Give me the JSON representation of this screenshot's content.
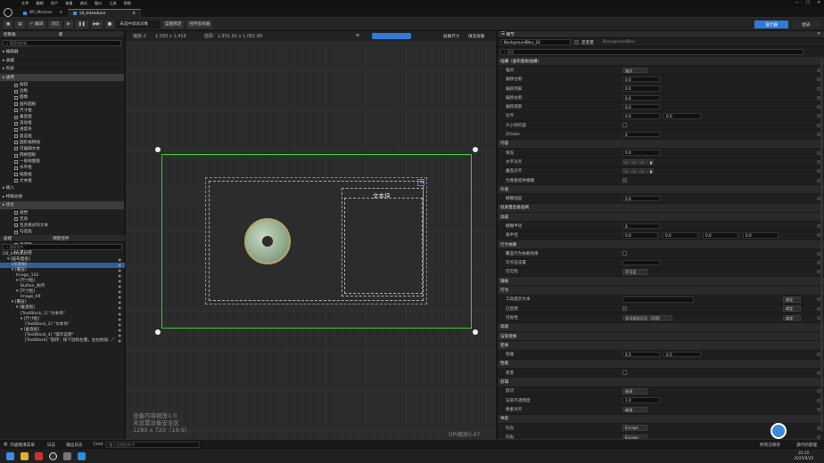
{
  "menu": {
    "items": [
      "文件",
      "编辑",
      "资产",
      "查看",
      "调试",
      "窗口",
      "工具",
      "帮助"
    ]
  },
  "window": {
    "controls": [
      "—",
      "☐",
      "✕"
    ]
  },
  "tabs": [
    {
      "label": "BP_Meshes"
    },
    {
      "label": "UI_Introduce"
    }
  ],
  "toolbar": {
    "compile_label": "编译",
    "diff_label": "对比",
    "debug_select": "未选中调试对象",
    "blueprint_label": "蓝图绑定",
    "asset_label": "控件反射器",
    "designer_label": "设计器",
    "graph_label": "图表"
  },
  "palette": {
    "title": "控制板",
    "library_title": "库",
    "search_placeholder": "搜索控制板",
    "categories_top": [
      "编辑器",
      "收藏",
      "列表",
      "通用"
    ],
    "common_items": [
      "按钮",
      "边框",
      "图像",
      "画布面板",
      "尺寸框",
      "垂直框",
      "滚动框",
      "进度条",
      "复选框",
      "圆形抛物线",
      "可编辑文本",
      "网格面板",
      "一般视图框",
      "水平框",
      "缩放框",
      "文本框"
    ],
    "categories_bottom": [
      "输入",
      "特殊效果",
      "优化"
    ],
    "optimization_items": [
      "视觉",
      "无效",
      "包含格式的文本",
      "勾选框",
      "文本",
      "滚动条",
      "垂直框"
    ]
  },
  "hierarchy": {
    "title": "层级",
    "bind_title": "绑定控件",
    "search_placeholder": "搜索控件",
    "rows": [
      {
        "text": "[UI_Introduce]",
        "indent": 0
      },
      {
        "text": "▾ [画布面板]",
        "indent": 1
      },
      {
        "text": "[背景图]",
        "indent": 2
      },
      {
        "text": "▾ [覆层]",
        "indent": 2
      },
      {
        "text": "Image_102",
        "indent": 3
      },
      {
        "text": "▾ [尺寸框]",
        "indent": 3
      },
      {
        "text": "Button_关闭",
        "indent": 4
      },
      {
        "text": "▾ [尺寸框]",
        "indent": 3
      },
      {
        "text": "Image_69",
        "indent": 4
      },
      {
        "text": "▾ [覆层]",
        "indent": 2
      },
      {
        "text": "▾ [垂直框]",
        "indent": 3
      },
      {
        "text": "[TextBlock_1] \"文本块\"",
        "indent": 4
      },
      {
        "text": "▾ [尺寸框]",
        "indent": 4
      },
      {
        "text": "[TextBlock_2] \"文本块\"",
        "indent": 5
      },
      {
        "text": "▾ [垂直框]",
        "indent": 4
      },
      {
        "text": "[TextBlock_4] \"操作说明\"",
        "indent": 5
      },
      {
        "text": "[TextBlock] \"旋转：按下鼠标左键，左右拖动…\"",
        "indent": 5
      }
    ]
  },
  "viewport": {
    "zoom": "缩放-2",
    "pos": "1,583 x 1,416",
    "select": "选择：1,931.92 x 1,061.80",
    "screen_size": "屏幕尺寸",
    "fill_screen": "填充屏幕",
    "dpi": "DPI缩放0.67",
    "info_line1": "设备内容缩放1.0",
    "info_line2": "未设置设备安全区",
    "info_line3": "1280 x 720（16:9）",
    "textblock_label": "文本块"
  },
  "details": {
    "title": "细节",
    "widget_name": "BackgroundBlur_24",
    "is_variable": "是变量",
    "class_name": "BackgroundBlur",
    "search_placeholder": "搜索",
    "rows": [
      {
        "type": "sec",
        "label": "插槽（画布面板插槽）"
      },
      {
        "type": "drop",
        "label": "锚点",
        "value": "锚点"
      },
      {
        "type": "val",
        "label": "偏移左侧",
        "value": "0.0"
      },
      {
        "type": "val",
        "label": "偏移顶部",
        "value": "0.0"
      },
      {
        "type": "val",
        "label": "偏移右侧",
        "value": "0.0"
      },
      {
        "type": "val",
        "label": "偏移底部",
        "value": "0.0"
      },
      {
        "type": "val2",
        "label": "对齐",
        "value": "0.0",
        "value2": "0.0"
      },
      {
        "type": "chk",
        "label": "大小到内容",
        "checked": false
      },
      {
        "type": "val",
        "label": "ZOrder",
        "value": "0"
      },
      {
        "type": "sec",
        "label": "内容"
      },
      {
        "type": "val",
        "label": "填充",
        "value": "0.0"
      },
      {
        "type": "icons",
        "label": "水平对齐"
      },
      {
        "type": "icons",
        "label": "垂直对齐"
      },
      {
        "type": "chk",
        "label": "为像素提供模糊",
        "checked": true
      },
      {
        "type": "sec",
        "label": "外观"
      },
      {
        "type": "val",
        "label": "模糊强度",
        "value": "0.0"
      },
      {
        "type": "sec",
        "label": "低质量后备画刷"
      },
      {
        "type": "sec",
        "label": "高级"
      },
      {
        "type": "val",
        "label": "模糊半径",
        "value": "0"
      },
      {
        "type": "val4",
        "label": "角半径",
        "value": "0.0",
        "value2": "0.0",
        "value3": "0.0",
        "value4": "0.0"
      },
      {
        "type": "sec",
        "label": "行为依赖"
      },
      {
        "type": "chk",
        "label": "覆盖行为依赖效果",
        "checked": false
      },
      {
        "type": "val",
        "label": "可点击设置",
        "value": ""
      },
      {
        "type": "drop",
        "label": "可见性",
        "value": "不可见"
      },
      {
        "type": "sec",
        "label": "辅助"
      },
      {
        "type": "sec",
        "label": "行为"
      },
      {
        "type": "wide",
        "label": "工具提示文本",
        "value": "",
        "bind": "绑定"
      },
      {
        "type": "chk",
        "label": "已启用",
        "checked": true,
        "bind": "绑定"
      },
      {
        "type": "drop",
        "label": "可视性",
        "value": "非可测试可见（可视）",
        "bind": "绑定"
      },
      {
        "type": "sec",
        "label": "高级"
      },
      {
        "type": "sec",
        "label": "渲染变换"
      },
      {
        "type": "sec",
        "label": "变换"
      },
      {
        "type": "val2",
        "label": "枢轴",
        "value": "0.5",
        "value2": "0.5"
      },
      {
        "type": "sec",
        "label": "性能"
      },
      {
        "type": "chk",
        "label": "易变",
        "checked": false
      },
      {
        "type": "sec",
        "label": "剪辑"
      },
      {
        "type": "drop",
        "label": "剪切",
        "value": "继承"
      },
      {
        "type": "val",
        "label": "渲染不透明度",
        "value": "1.0"
      },
      {
        "type": "drop",
        "label": "像素对齐",
        "value": "继承"
      },
      {
        "type": "sec",
        "label": "导航"
      },
      {
        "type": "drop",
        "label": "向左",
        "value": "Escape"
      },
      {
        "type": "drop",
        "label": "向右",
        "value": "Escape"
      },
      {
        "type": "drop",
        "label": "向上键",
        "value": "Escape"
      }
    ]
  },
  "bottom": {
    "items": [
      "内容侧滑菜单",
      "日志",
      "输出日志",
      "Cmd"
    ],
    "cmd_placeholder": "输入控制台命令",
    "right_items": [
      "所有已保存",
      "源代码管理"
    ]
  },
  "taskbar": {
    "time": "22:10",
    "date": "2025/6/20"
  }
}
